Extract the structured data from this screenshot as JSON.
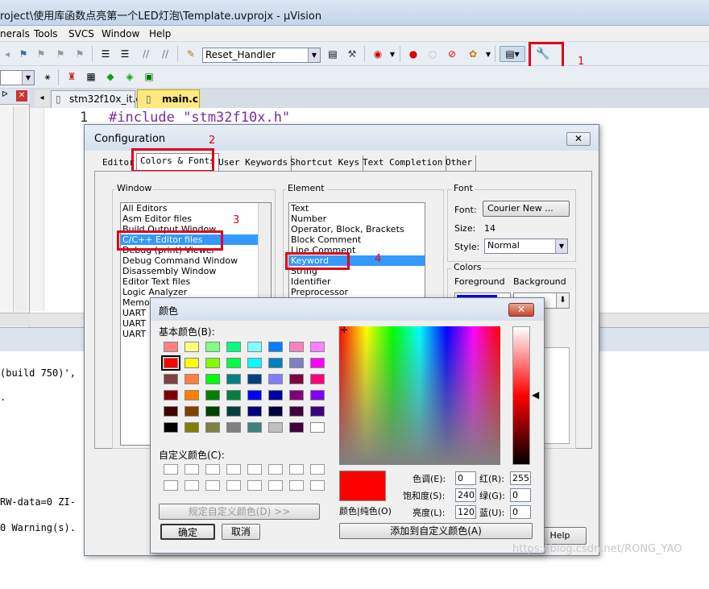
{
  "window": {
    "title": "roject\\使用库函数点亮第一个LED灯泡\\Template.uvprojx - µVision"
  },
  "menu": [
    "nerals",
    "Tools",
    "SVCS",
    "Window",
    "Help"
  ],
  "toolbar": {
    "target_combo": "Reset_Handler"
  },
  "annotations": [
    "1",
    "2",
    "3",
    "4"
  ],
  "editor_tabs": [
    {
      "label": "stm32f10x_it.c"
    },
    {
      "label": "main.c"
    }
  ],
  "editor": {
    "line_number": "1",
    "code": "#include \"stm32f10x.h\""
  },
  "build_output": [
    "(build 750)',",
    ".",
    "RW-data=0 ZI-",
    "0 Warning(s)."
  ],
  "config": {
    "title": "Configuration",
    "close": "✕",
    "tabs": [
      "Editor",
      "Colors & Fonts",
      "User Keywords",
      "Shortcut Keys",
      "Text Completion",
      "Other"
    ],
    "window_group": "Window",
    "window_items": [
      "All Editors",
      "Asm Editor files",
      "Build Output Window",
      "C/C++ Editor files",
      "Debug (print) Viewer",
      "Debug Command Window",
      "Disassembly Window",
      "Editor Text files",
      "Logic Analyzer",
      "Memory",
      "UART",
      "UART",
      "UART"
    ],
    "element_group": "Element",
    "element_items": [
      "Text",
      "Number",
      "Operator, Block, Brackets",
      "Block Comment",
      "Line Comment",
      "Keyword",
      "String",
      "Identifier",
      "Preprocessor"
    ],
    "font_group": "Font",
    "font_label": "Font:",
    "font_value": "Courier New ...",
    "size_label": "Size:",
    "size_value": "14",
    "style_label": "Style:",
    "style_value": "Normal",
    "colors_group": "Colors",
    "foreground": "Foreground",
    "background": "Background",
    "help": "Help"
  },
  "color_dialog": {
    "title": "颜色",
    "close": "✕",
    "basic_label": "基本颜色(B):",
    "basic_colors": [
      "#ff8080",
      "#ffff80",
      "#80ff80",
      "#00ff80",
      "#80ffff",
      "#0080ff",
      "#ff80c0",
      "#ff80ff",
      "#ff0000",
      "#ffff00",
      "#80ff00",
      "#00ff40",
      "#00ffff",
      "#0080c0",
      "#8080c0",
      "#ff00ff",
      "#804040",
      "#ff8040",
      "#00ff00",
      "#008080",
      "#004080",
      "#8080ff",
      "#800040",
      "#ff0080",
      "#800000",
      "#ff8000",
      "#008000",
      "#008040",
      "#0000ff",
      "#0000a0",
      "#800080",
      "#8000ff",
      "#400000",
      "#804000",
      "#004000",
      "#004040",
      "#000080",
      "#000040",
      "#400040",
      "#400080",
      "#000000",
      "#808000",
      "#808040",
      "#808080",
      "#408080",
      "#c0c0c0",
      "#400040",
      "#ffffff"
    ],
    "custom_label": "自定义颜色(C):",
    "define_custom": "规定自定义颜色(D) >>",
    "ok": "确定",
    "cancel": "取消",
    "solid_label": "颜色|纯色(O)",
    "hue_label": "色调(E):",
    "hue": "0",
    "sat_label": "饱和度(S):",
    "sat": "240",
    "lum_label": "亮度(L):",
    "lum": "120",
    "red_label": "红(R):",
    "red": "255",
    "green_label": "绿(G):",
    "green": "0",
    "blue_label": "蓝(U):",
    "blue": "0",
    "add_custom": "添加到自定义颜色(A)"
  },
  "watermark": "https://blog.csdn.net/RONG_YAO"
}
